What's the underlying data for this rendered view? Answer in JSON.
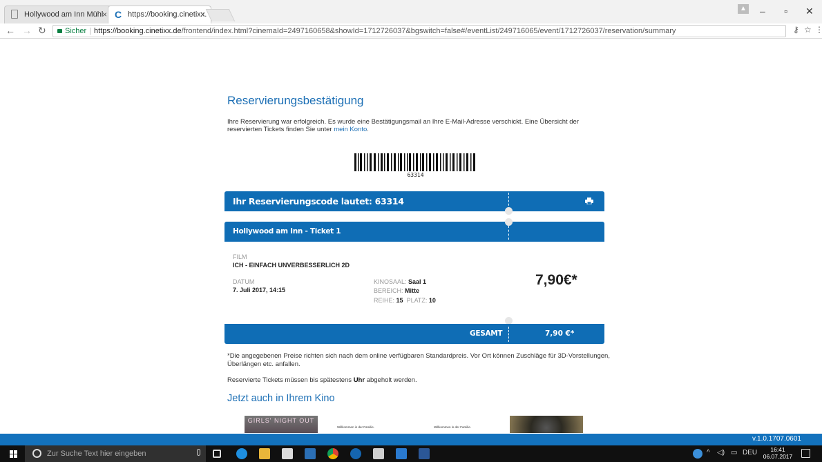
{
  "browser": {
    "tabs": [
      {
        "label": "Hollywood am Inn Mühl"
      },
      {
        "label": "https://booking.cinetixx."
      }
    ],
    "address": {
      "security_label": "Sicher",
      "url_host": "https://booking.cinetixx.de",
      "url_path": "/frontend/index.html?cinemaId=2497160658&showId=1712726037&bgswitch=false#/eventList/249716065/event/1712726037/reservation/summary"
    }
  },
  "page": {
    "title": "Reservierungsbestätigung",
    "intro_text": "Ihre Reservierung war erfolgreich. Es wurde eine Bestätigungsmail an Ihre E-Mail-Adresse verschickt. Eine Übersicht der reservierten Tickets finden Sie unter ",
    "intro_link": "mein Konto",
    "intro_end": ".",
    "barcode_number": "63314",
    "reservation_bar": "Ihr Reservierungscode lautet: 63314",
    "ticket_header": "Hollywood am Inn - Ticket 1",
    "ticket": {
      "film_label": "FILM",
      "film_value": "ICH - EINFACH UNVERBESSERLICH 2D",
      "date_label": "DATUM",
      "date_value": "7. Juli 2017, 14:15",
      "hall_label": "KINOSAAL:",
      "hall_value": "Saal 1",
      "area_label": "BEREICH:",
      "area_value": "Mitte",
      "row_label": "REIHE:",
      "row_value": "15",
      "seat_label": "PLATZ:",
      "seat_value": "10",
      "price": "7,90€*"
    },
    "total_label": "GESAMT",
    "total_value": "7,90 €*",
    "disclaimer": "*Die angegebenen Preise richten sich nach dem online verfügbaren Standardpreis. Vor Ort können Zuschläge für 3D-Vorstellungen, Überlängen etc. anfallen.",
    "pickup_prefix": "Reservierte Tickets müssen bis spätestens ",
    "pickup_bold": "Uhr",
    "pickup_suffix": " abgeholt werden.",
    "section_title": "Jetzt auch in Ihrem Kino",
    "thumbs": {
      "a": "GIRLS' NIGHT OUT",
      "b": "Willkommen in der Familie.",
      "c": "Willkommen in der Familie."
    },
    "version": "v.1.0.1707.0601"
  },
  "taskbar": {
    "search_placeholder": "Zur Suche Text hier eingeben",
    "language": "DEU",
    "time": "16:41",
    "date": "06.07.2017"
  },
  "colors": {
    "brand_blue": "#0f6db5",
    "link_blue": "#1c6fb5"
  }
}
